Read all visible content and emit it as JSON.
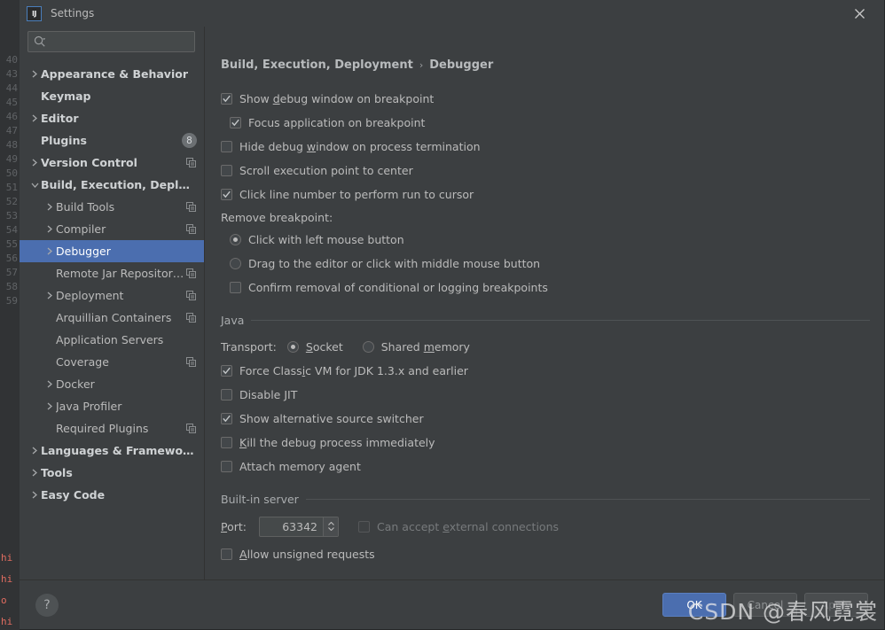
{
  "window": {
    "title": "Settings",
    "logo_text": "IJ",
    "close_icon": "close-icon"
  },
  "search": {
    "placeholder": "",
    "value": "",
    "icon": "search-icon",
    "dropdown_icon": "chevron-down-icon"
  },
  "sidebar": {
    "items": [
      {
        "label": "Appearance & Behavior",
        "indent": 0,
        "arrow": "right",
        "bold": true,
        "badge": null,
        "copy": false,
        "selected": false
      },
      {
        "label": "Keymap",
        "indent": 0,
        "arrow": "none",
        "bold": true,
        "badge": null,
        "copy": false,
        "selected": false
      },
      {
        "label": "Editor",
        "indent": 0,
        "arrow": "right",
        "bold": true,
        "badge": null,
        "copy": false,
        "selected": false
      },
      {
        "label": "Plugins",
        "indent": 0,
        "arrow": "none",
        "bold": true,
        "badge": "8",
        "copy": false,
        "selected": false
      },
      {
        "label": "Version Control",
        "indent": 0,
        "arrow": "right",
        "bold": true,
        "badge": null,
        "copy": true,
        "selected": false
      },
      {
        "label": "Build, Execution, Deployment",
        "indent": 0,
        "arrow": "down",
        "bold": true,
        "badge": null,
        "copy": false,
        "selected": false
      },
      {
        "label": "Build Tools",
        "indent": 1,
        "arrow": "right",
        "bold": false,
        "badge": null,
        "copy": true,
        "selected": false
      },
      {
        "label": "Compiler",
        "indent": 1,
        "arrow": "right",
        "bold": false,
        "badge": null,
        "copy": true,
        "selected": false
      },
      {
        "label": "Debugger",
        "indent": 1,
        "arrow": "right",
        "bold": false,
        "badge": null,
        "copy": false,
        "selected": true
      },
      {
        "label": "Remote Jar Repositories",
        "indent": 1,
        "arrow": "none",
        "bold": false,
        "badge": null,
        "copy": true,
        "selected": false
      },
      {
        "label": "Deployment",
        "indent": 1,
        "arrow": "right",
        "bold": false,
        "badge": null,
        "copy": true,
        "selected": false
      },
      {
        "label": "Arquillian Containers",
        "indent": 1,
        "arrow": "none",
        "bold": false,
        "badge": null,
        "copy": true,
        "selected": false
      },
      {
        "label": "Application Servers",
        "indent": 1,
        "arrow": "none",
        "bold": false,
        "badge": null,
        "copy": false,
        "selected": false
      },
      {
        "label": "Coverage",
        "indent": 1,
        "arrow": "none",
        "bold": false,
        "badge": null,
        "copy": true,
        "selected": false
      },
      {
        "label": "Docker",
        "indent": 1,
        "arrow": "right",
        "bold": false,
        "badge": null,
        "copy": false,
        "selected": false
      },
      {
        "label": "Java Profiler",
        "indent": 1,
        "arrow": "right",
        "bold": false,
        "badge": null,
        "copy": false,
        "selected": false
      },
      {
        "label": "Required Plugins",
        "indent": 1,
        "arrow": "none",
        "bold": false,
        "badge": null,
        "copy": true,
        "selected": false
      },
      {
        "label": "Languages & Frameworks",
        "indent": 0,
        "arrow": "right",
        "bold": true,
        "badge": null,
        "copy": false,
        "selected": false
      },
      {
        "label": "Tools",
        "indent": 0,
        "arrow": "right",
        "bold": true,
        "badge": null,
        "copy": false,
        "selected": false
      },
      {
        "label": "Easy Code",
        "indent": 0,
        "arrow": "right",
        "bold": true,
        "badge": null,
        "copy": false,
        "selected": false
      }
    ]
  },
  "main": {
    "breadcrumb": {
      "root": "Build, Execution, Deployment",
      "separator": "›",
      "leaf": "Debugger"
    },
    "top_options": [
      {
        "pre": "Show ",
        "mn": "d",
        "post": "ebug window on breakpoint",
        "checked": true,
        "indent": false,
        "disabled": false
      },
      {
        "pre": "Focus application on breakpoint",
        "mn": "",
        "post": "",
        "checked": true,
        "indent": true,
        "disabled": false
      },
      {
        "pre": "Hide debug ",
        "mn": "w",
        "post": "indow on process termination",
        "checked": false,
        "indent": false,
        "disabled": false
      },
      {
        "pre": "Scroll execution point to center",
        "mn": "",
        "post": "",
        "checked": false,
        "indent": false,
        "disabled": false
      },
      {
        "pre": "Click line number to perform run to cursor",
        "mn": "",
        "post": "",
        "checked": true,
        "indent": false,
        "disabled": false
      }
    ],
    "remove_breakpoint": {
      "label": "Remove breakpoint:",
      "radios": [
        {
          "label": "Click with left mouse button",
          "selected": true
        },
        {
          "label": "Drag to the editor or click with middle mouse button",
          "selected": false
        }
      ],
      "checkbox": {
        "label": "Confirm removal of conditional or logging breakpoints",
        "checked": false
      }
    },
    "java_section": {
      "title": "Java",
      "transport_label": "Transport:",
      "transport_options": [
        {
          "pre": "",
          "mn": "S",
          "post": "ocket",
          "selected": true
        },
        {
          "pre": "Shared ",
          "mn": "m",
          "post": "emory",
          "selected": false
        }
      ],
      "checkboxes": [
        {
          "pre": "Force Class",
          "mn": "i",
          "post": "c VM for JDK 1.3.x and earlier",
          "checked": true,
          "disabled": false
        },
        {
          "pre": "Disable JIT",
          "mn": "",
          "post": "",
          "checked": false,
          "disabled": false
        },
        {
          "pre": "Show alternative source switcher",
          "mn": "",
          "post": "",
          "checked": true,
          "disabled": false
        },
        {
          "pre": "",
          "mn": "K",
          "post": "ill the debug process immediately",
          "checked": false,
          "disabled": false
        },
        {
          "pre": "Attach memory agent",
          "mn": "",
          "post": "",
          "checked": false,
          "disabled": false
        }
      ]
    },
    "builtin_section": {
      "title": "Built-in server",
      "port_label_pre": "",
      "port_label_mn": "P",
      "port_label_post": "ort:",
      "port_value": "63342",
      "external": {
        "pre": "Can accept ",
        "mn": "e",
        "post": "xternal connections",
        "checked": false,
        "disabled": true
      },
      "unsigned": {
        "pre": "",
        "mn": "A",
        "post": "llow unsigned requests",
        "checked": false,
        "disabled": false
      }
    }
  },
  "footer": {
    "help_label": "?",
    "ok": "OK",
    "cancel": "Cancel",
    "apply": "Apply"
  },
  "watermark": "CSDN @春风霓裳",
  "background": {
    "gutter_numbers": [
      "40",
      "43",
      "44",
      "45",
      "46",
      "47",
      "48",
      "49",
      "50",
      "51",
      "52",
      "53",
      "54",
      "55",
      "56",
      "57",
      "58",
      "59"
    ],
    "terminal_lines": [
      "hi",
      "hi",
      "o",
      "hi"
    ]
  },
  "colors": {
    "accent": "#4b6eaf",
    "dialog_bg": "#3c3f41",
    "text": "#bbbbbb",
    "selected_text": "#ffffff"
  }
}
